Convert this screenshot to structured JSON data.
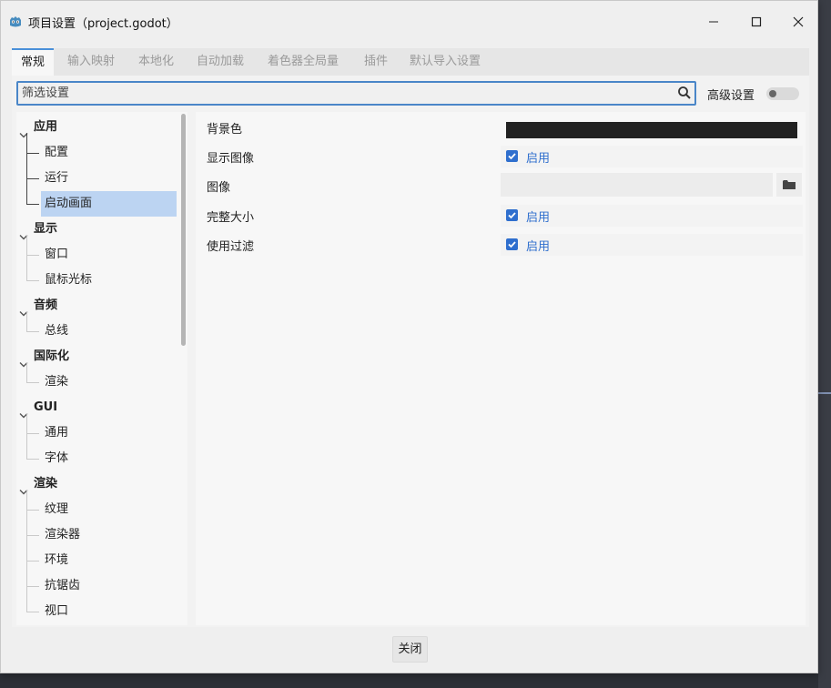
{
  "window": {
    "title": "项目设置（project.godot）"
  },
  "tabs": [
    "常规",
    "输入映射",
    "本地化",
    "自动加载",
    "着色器全局量",
    "插件",
    "默认导入设置"
  ],
  "search": {
    "placeholder": "筛选设置",
    "value": ""
  },
  "advanced": {
    "label": "高级设置",
    "enabled": false
  },
  "tree": [
    {
      "label": "应用",
      "children": [
        "配置",
        "运行",
        "启动画面"
      ]
    },
    {
      "label": "显示",
      "children": [
        "窗口",
        "鼠标光标"
      ]
    },
    {
      "label": "音频",
      "children": [
        "总线"
      ]
    },
    {
      "label": "国际化",
      "children": [
        "渲染"
      ]
    },
    {
      "label": "GUI",
      "children": [
        "通用",
        "字体"
      ]
    },
    {
      "label": "渲染",
      "children": [
        "纹理",
        "渲染器",
        "环境",
        "抗锯齿",
        "视口"
      ]
    }
  ],
  "tree_selected": "启动画面",
  "settings": {
    "bg_color": {
      "label": "背景色",
      "color": "#222222"
    },
    "show_image": {
      "label": "显示图像",
      "checked": true,
      "value": "启用"
    },
    "image": {
      "label": "图像",
      "value": ""
    },
    "full_size": {
      "label": "完整大小",
      "checked": true,
      "value": "启用"
    },
    "use_filter": {
      "label": "使用过滤",
      "checked": true,
      "value": "启用"
    }
  },
  "footer": {
    "close_label": "关闭"
  },
  "colors": {
    "accent": "#2f6fce",
    "selection": "#bcd4f2",
    "godot_icon": "#478cbf"
  }
}
